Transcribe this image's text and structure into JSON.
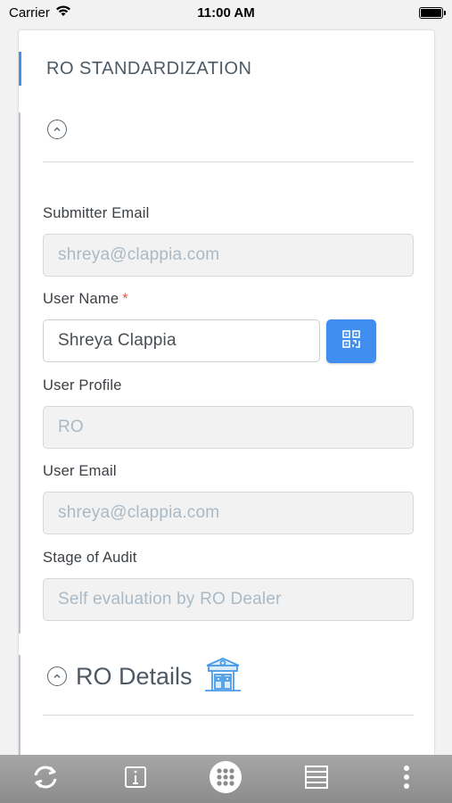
{
  "status_bar": {
    "carrier": "Carrier",
    "time": "11:00 AM"
  },
  "form": {
    "title": "RO STANDARDIZATION",
    "fields": [
      {
        "label": "Submitter Email",
        "value": "shreya@clappia.com",
        "editable": false
      },
      {
        "label": "User Name",
        "required_mark": "*",
        "value": "Shreya Clappia",
        "editable": true
      },
      {
        "label": "User Profile",
        "value": "RO",
        "editable": false
      },
      {
        "label": "User Email",
        "value": "shreya@clappia.com",
        "editable": false
      },
      {
        "label": "Stage of Audit",
        "value": "Self evaluation by RO Dealer",
        "editable": false
      }
    ],
    "details_section_title": "RO Details"
  },
  "colors": {
    "accent": "#4a90e2",
    "scan_button": "#3f8ef0",
    "required": "#e2574c",
    "toolbar": "#9a9a9a"
  },
  "icons": {
    "scan_button": "qr-code-icon",
    "details_section": "fuel-station-icon",
    "toolbar": [
      "sync-icon",
      "info-icon",
      "grid-menu-icon",
      "list-icon",
      "more-vertical-icon"
    ]
  }
}
